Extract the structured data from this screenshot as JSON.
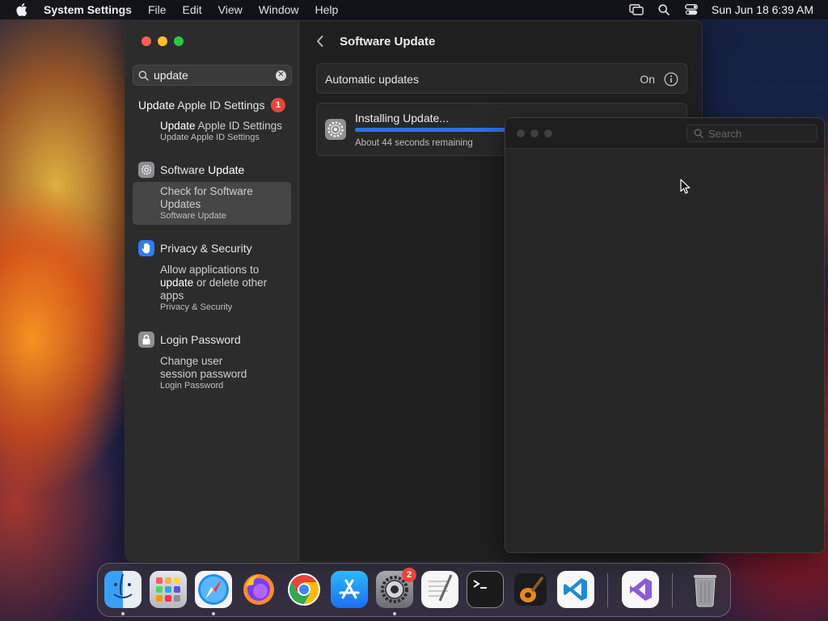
{
  "menubar": {
    "app_name": "System Settings",
    "items": [
      "File",
      "Edit",
      "View",
      "Window",
      "Help"
    ],
    "clock": "Sun Jun 18  6:39 AM"
  },
  "sidebar": {
    "search": {
      "value": "update"
    },
    "sections": [
      {
        "title_match": "Update",
        "title_rest": " Apple ID Settings",
        "badge": "1",
        "result": {
          "match": "Update",
          "rest": " Apple ID Settings",
          "sub": "Update Apple ID Settings"
        }
      },
      {
        "title_plain": "Software ",
        "title_match": "Update",
        "result": {
          "line1": "Check for Software",
          "line2": "Updates",
          "sub": "Software Update"
        }
      },
      {
        "title": "Privacy & Security",
        "result": {
          "line1": "Allow applications to",
          "match": "update",
          "rest": " or delete other",
          "line3": "apps",
          "sub": "Privacy & Security"
        }
      },
      {
        "title": "Login Password",
        "result": {
          "line1": "Change user",
          "line2": "session password",
          "sub": "Login Password"
        }
      }
    ]
  },
  "main": {
    "title": "Software Update",
    "automatic_updates": {
      "label": "Automatic updates",
      "value": "On"
    },
    "install": {
      "title": "Installing Update...",
      "remaining": "About 44 seconds remaining",
      "progress": 0.48
    }
  },
  "blank_window": {
    "search_placeholder": "Search"
  },
  "dock": {
    "apps": [
      {
        "name": "Finder",
        "running": true
      },
      {
        "name": "Launchpad",
        "running": false
      },
      {
        "name": "Safari",
        "running": true
      },
      {
        "name": "Firefox",
        "running": false
      },
      {
        "name": "Chrome",
        "running": false
      },
      {
        "name": "App Store",
        "running": false
      },
      {
        "name": "System Settings",
        "running": true,
        "badge": "2"
      },
      {
        "name": "TextEdit",
        "running": false
      },
      {
        "name": "Terminal",
        "running": false
      },
      {
        "name": "GarageBand",
        "running": false
      },
      {
        "name": "Visual Studio Code",
        "running": false
      },
      {
        "name": "Visual Studio",
        "running": false
      },
      {
        "name": "Trash",
        "running": false
      }
    ]
  },
  "colors": {
    "accent": "#2a73e8",
    "badge": "#e8453c"
  }
}
